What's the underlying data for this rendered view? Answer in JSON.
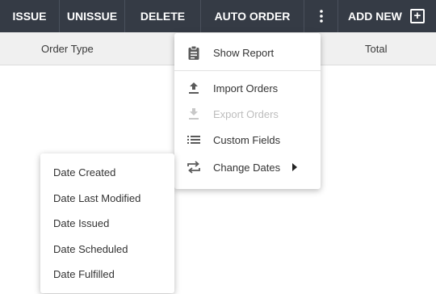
{
  "toolbar": {
    "buttons": [
      {
        "label": "ISSUE"
      },
      {
        "label": "UNISSUE"
      },
      {
        "label": "DELETE"
      },
      {
        "label": "AUTO ORDER"
      }
    ],
    "more_icon": "more-vertical-icon",
    "add_new_label": "ADD NEW",
    "add_icon": "plus-square-icon",
    "background": "#353b45"
  },
  "table": {
    "columns": [
      "Order Type",
      "Total"
    ]
  },
  "actions_menu": {
    "items": [
      {
        "label": "Show Report",
        "icon": "clipboard-icon",
        "disabled": false
      },
      {
        "label": "Import Orders",
        "icon": "upload-icon",
        "disabled": false
      },
      {
        "label": "Export Orders",
        "icon": "download-icon",
        "disabled": true
      },
      {
        "label": "Custom Fields",
        "icon": "list-icon",
        "disabled": false
      },
      {
        "label": "Change Dates",
        "icon": "swap-icon",
        "disabled": false,
        "has_submenu": true
      }
    ]
  },
  "change_dates_submenu": {
    "items": [
      {
        "label": "Date Created"
      },
      {
        "label": "Date Last Modified"
      },
      {
        "label": "Date Issued"
      },
      {
        "label": "Date Scheduled"
      },
      {
        "label": "Date Fulfilled"
      }
    ]
  }
}
